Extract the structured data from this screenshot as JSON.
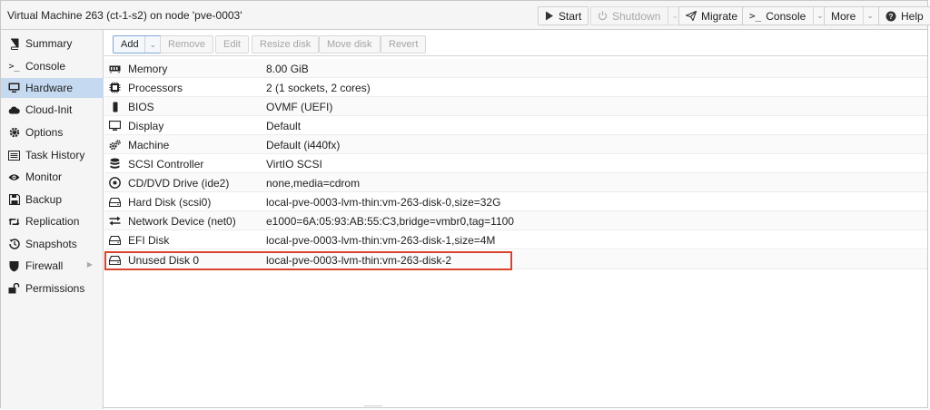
{
  "header": {
    "title": "Virtual Machine 263 (ct-1-s2) on node 'pve-0003'",
    "buttons": {
      "start": "Start",
      "shutdown": "Shutdown",
      "migrate": "Migrate",
      "console": "Console",
      "more": "More",
      "help": "Help"
    }
  },
  "sidebar": {
    "items": [
      {
        "label": "Summary",
        "icon": "book-icon"
      },
      {
        "label": "Console",
        "icon": "terminal-icon"
      },
      {
        "label": "Hardware",
        "icon": "monitor-icon",
        "active": true
      },
      {
        "label": "Cloud-Init",
        "icon": "cloud-icon"
      },
      {
        "label": "Options",
        "icon": "gear-icon"
      },
      {
        "label": "Task History",
        "icon": "list-icon"
      },
      {
        "label": "Monitor",
        "icon": "eye-icon"
      },
      {
        "label": "Backup",
        "icon": "floppy-icon"
      },
      {
        "label": "Replication",
        "icon": "retweet-icon"
      },
      {
        "label": "Snapshots",
        "icon": "history-icon"
      },
      {
        "label": "Firewall",
        "icon": "shield-icon"
      },
      {
        "label": "Permissions",
        "icon": "unlock-icon"
      }
    ]
  },
  "toolbar": {
    "add": "Add",
    "remove": "Remove",
    "edit": "Edit",
    "resize_disk": "Resize disk",
    "move_disk": "Move disk",
    "revert": "Revert"
  },
  "hardware": {
    "rows": [
      {
        "name": "Memory",
        "value": "8.00 GiB",
        "icon": "memory-icon"
      },
      {
        "name": "Processors",
        "value": "2 (1 sockets, 2 cores)",
        "icon": "cpu-icon"
      },
      {
        "name": "BIOS",
        "value": "OVMF (UEFI)",
        "icon": "chip-icon"
      },
      {
        "name": "Display",
        "value": "Default",
        "icon": "desktop-icon"
      },
      {
        "name": "Machine",
        "value": "Default (i440fx)",
        "icon": "cogs-icon"
      },
      {
        "name": "SCSI Controller",
        "value": "VirtIO SCSI",
        "icon": "database-icon"
      },
      {
        "name": "CD/DVD Drive (ide2)",
        "value": "none,media=cdrom",
        "icon": "cdrom-icon"
      },
      {
        "name": "Hard Disk (scsi0)",
        "value": "local-pve-0003-lvm-thin:vm-263-disk-0,size=32G",
        "icon": "hdd-icon"
      },
      {
        "name": "Network Device (net0)",
        "value": "e1000=6A:05:93:AB:55:C3,bridge=vmbr0,tag=1100",
        "icon": "exchange-icon"
      },
      {
        "name": "EFI Disk",
        "value": "local-pve-0003-lvm-thin:vm-263-disk-1,size=4M",
        "icon": "hdd-icon"
      },
      {
        "name": "Unused Disk 0",
        "value": "local-pve-0003-lvm-thin:vm-263-disk-2",
        "icon": "hdd-icon",
        "highlighted": true
      }
    ]
  },
  "colors": {
    "active_nav": "#c5daf0",
    "highlight_border": "#d9452c"
  }
}
